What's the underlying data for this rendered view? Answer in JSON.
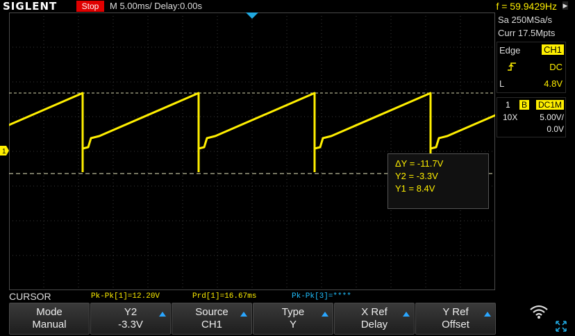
{
  "header": {
    "brand": "SIGLENT",
    "run_state": "Stop",
    "timebase": "M 5.00ms/ Delay:0.00s",
    "frequency": "f = 59.9429Hz"
  },
  "acquisition": {
    "sample_rate": "Sa 250MSa/s",
    "memory_depth": "Curr 17.5Mpts"
  },
  "trigger": {
    "type": "Edge",
    "source": "CH1",
    "coupling": "DC",
    "level_label": "L",
    "level": "4.8V"
  },
  "channel": {
    "number": "1",
    "bw_label": "B",
    "coupling": "DC1M",
    "probe": "10X",
    "scale": "5.00V/",
    "offset": "0.0V",
    "marker": "1"
  },
  "cursor_readout": {
    "delta_y": "ΔY = -11.7V",
    "y2": "Y2 = -3.3V",
    "y1": "Y1 = 8.4V"
  },
  "measurements": {
    "mode": "CURSOR",
    "m1": "Pk-Pk[1]=12.20V",
    "m2": "Prd[1]=16.67ms",
    "m3": "Pk-Pk[3]=****"
  },
  "softkeys": [
    {
      "label": "Mode",
      "value": "Manual",
      "has_arrow": false
    },
    {
      "label": "Y2",
      "value": "-3.3V",
      "has_arrow": true
    },
    {
      "label": "Source",
      "value": "CH1",
      "has_arrow": true
    },
    {
      "label": "Type",
      "value": "Y",
      "has_arrow": true
    },
    {
      "label": "X Ref",
      "value": "Delay",
      "has_arrow": true
    },
    {
      "label": "Y Ref",
      "value": "Offset",
      "has_arrow": true
    }
  ],
  "colors": {
    "channel1": "#ffef00",
    "run_state_bg": "#e00000",
    "trigger_marker": "#20a8e0",
    "info_blue": "#20c0ff"
  },
  "icons": {
    "wifi": "wifi-icon",
    "fullscreen": "fullscreen-icon"
  }
}
